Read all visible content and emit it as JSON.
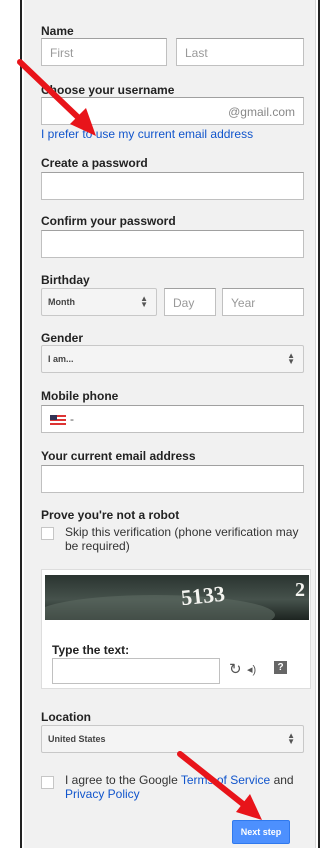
{
  "form": {
    "name_label": "Name",
    "first_placeholder": "First",
    "last_placeholder": "Last",
    "username_label": "Choose your username",
    "username_suffix": "@gmail.com",
    "use_email_link": "I prefer to use my current email address",
    "password_label": "Create a password",
    "confirm_label": "Confirm your password",
    "birthday_label": "Birthday",
    "month_value": "Month",
    "day_placeholder": "Day",
    "year_placeholder": "Year",
    "gender_label": "Gender",
    "gender_value": "I am...",
    "mobile_label": "Mobile phone",
    "mobile_prefix": "-",
    "current_email_label": "Your current email address",
    "robot_label": "Prove you're not a robot",
    "skip_text": "Skip this verification (phone verification may be required)",
    "captcha_text_1": "5133",
    "captcha_text_2": "2",
    "type_text_label": "Type the text:",
    "refresh_icon": "↻",
    "audio_icon": "◂)",
    "help_icon": "?",
    "location_label": "Location",
    "location_value": "United States",
    "agree_prefix": "I agree to the Google ",
    "terms_link": "Terms of Service",
    "agree_and": " and",
    "privacy_link": "Privacy Policy",
    "next_button": "Next step"
  },
  "colors": {
    "link": "#1155cc",
    "button": "#4d90fe",
    "arrow": "#e8141a"
  }
}
